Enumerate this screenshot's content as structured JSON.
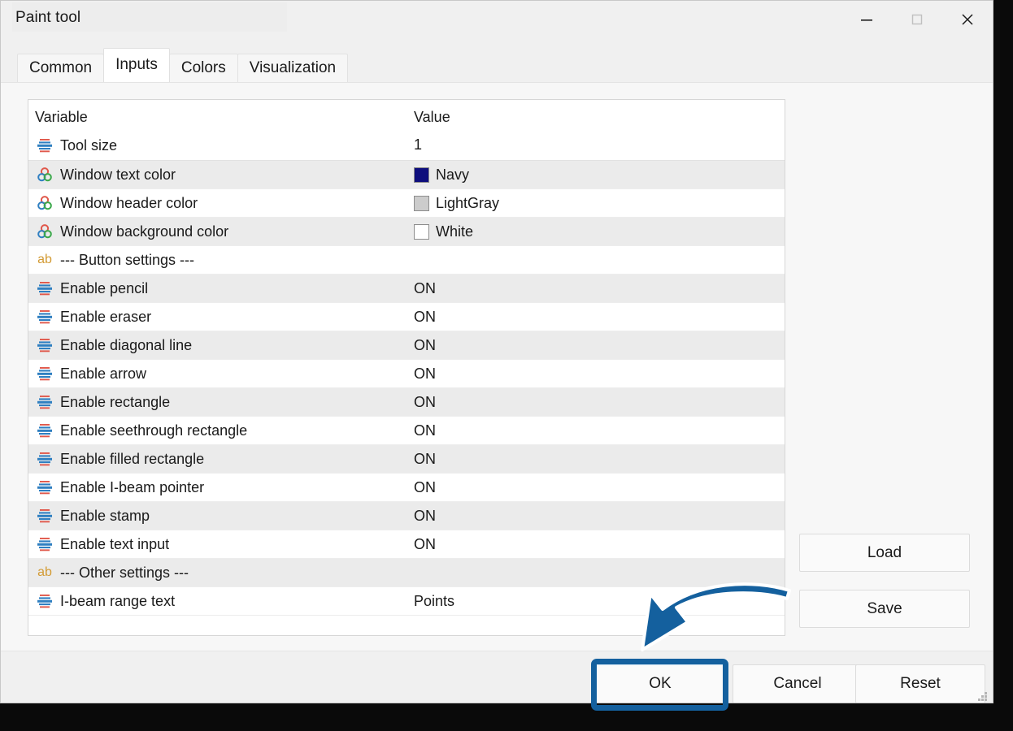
{
  "window": {
    "title": "Paint tool",
    "controls": [
      {
        "name": "minimize",
        "glyph": "minimize-icon"
      },
      {
        "name": "maximize",
        "glyph": "maximize-icon"
      },
      {
        "name": "close",
        "glyph": "close-icon"
      }
    ]
  },
  "tabs": [
    {
      "label": "Common",
      "active": false
    },
    {
      "label": "Inputs",
      "active": true
    },
    {
      "label": "Colors",
      "active": false
    },
    {
      "label": "Visualization",
      "active": false
    }
  ],
  "table": {
    "columns": [
      "Variable",
      "Value"
    ],
    "rows": [
      {
        "icon": "levels",
        "name": "Tool size",
        "value": "1",
        "swatch": null,
        "stripe": "header"
      },
      {
        "icon": "colors",
        "name": "Window text color",
        "value": "Navy",
        "swatch": "#0e0e7d",
        "stripe": "alt"
      },
      {
        "icon": "colors",
        "name": "Window header color",
        "value": "LightGray",
        "swatch": "#cccccc",
        "stripe": "plain"
      },
      {
        "icon": "colors",
        "name": "Window background color",
        "value": "White",
        "swatch": "#ffffff",
        "stripe": "alt"
      },
      {
        "icon": "ab",
        "name": "--- Button settings ---",
        "value": "",
        "swatch": null,
        "stripe": "plain"
      },
      {
        "icon": "levels",
        "name": "Enable pencil",
        "value": "ON",
        "swatch": null,
        "stripe": "alt"
      },
      {
        "icon": "levels",
        "name": "Enable eraser",
        "value": "ON",
        "swatch": null,
        "stripe": "plain"
      },
      {
        "icon": "levels",
        "name": "Enable diagonal line",
        "value": "ON",
        "swatch": null,
        "stripe": "alt"
      },
      {
        "icon": "levels",
        "name": "Enable arrow",
        "value": "ON",
        "swatch": null,
        "stripe": "plain"
      },
      {
        "icon": "levels",
        "name": "Enable rectangle",
        "value": "ON",
        "swatch": null,
        "stripe": "alt"
      },
      {
        "icon": "levels",
        "name": "Enable seethrough rectangle",
        "value": "ON",
        "swatch": null,
        "stripe": "plain"
      },
      {
        "icon": "levels",
        "name": "Enable filled rectangle",
        "value": "ON",
        "swatch": null,
        "stripe": "alt"
      },
      {
        "icon": "levels",
        "name": "Enable I-beam pointer",
        "value": "ON",
        "swatch": null,
        "stripe": "plain"
      },
      {
        "icon": "levels",
        "name": "Enable stamp",
        "value": "ON",
        "swatch": null,
        "stripe": "alt"
      },
      {
        "icon": "levels",
        "name": "Enable text input",
        "value": "ON",
        "swatch": null,
        "stripe": "plain"
      },
      {
        "icon": "ab",
        "name": "--- Other settings ---",
        "value": "",
        "swatch": null,
        "stripe": "alt"
      },
      {
        "icon": "levels",
        "name": "I-beam range text",
        "value": "Points",
        "swatch": null,
        "stripe": "plain"
      }
    ]
  },
  "side_buttons": [
    {
      "label": "Load"
    },
    {
      "label": "Save"
    }
  ],
  "footer_buttons": [
    {
      "label": "OK",
      "highlighted": true
    },
    {
      "label": "Cancel",
      "highlighted": false
    },
    {
      "label": "Reset",
      "highlighted": false
    }
  ],
  "annotation": {
    "arrow_color": "#14609e",
    "highlight_color": "#14609e",
    "target": "OK"
  }
}
